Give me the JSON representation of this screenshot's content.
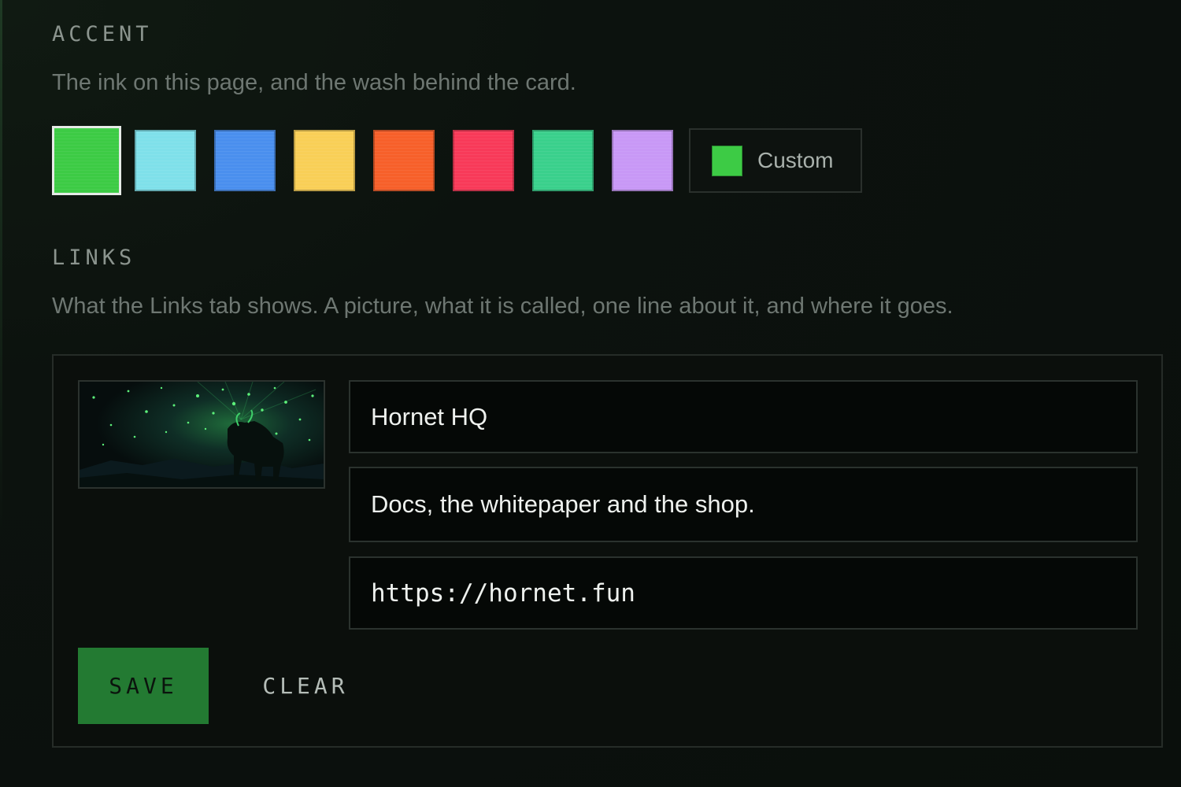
{
  "accent": {
    "label": "ACCENT",
    "description": "The ink on this page, and the wash behind the card.",
    "swatches": [
      {
        "name": "green",
        "color": "#3dcb45",
        "selected": true
      },
      {
        "name": "cyan",
        "color": "#7fe0ea",
        "selected": false
      },
      {
        "name": "blue",
        "color": "#4a8fee",
        "selected": false
      },
      {
        "name": "yellow",
        "color": "#f9cf57",
        "selected": false
      },
      {
        "name": "orange",
        "color": "#f7602a",
        "selected": false
      },
      {
        "name": "red",
        "color": "#f83a59",
        "selected": false
      },
      {
        "name": "teal",
        "color": "#3ad08c",
        "selected": false
      },
      {
        "name": "purple",
        "color": "#c898f6",
        "selected": false
      }
    ],
    "custom": {
      "label": "Custom",
      "color": "#3dcb45"
    }
  },
  "links": {
    "label": "LINKS",
    "description": "What the Links tab shows. A picture, what it is called, one line about it, and where it goes.",
    "item": {
      "image_icon": "bull-under-green-starfield-image",
      "title": "Hornet HQ",
      "description": "Docs, the whitepaper and the shop.",
      "url": "https://hornet.fun"
    },
    "save_label": "SAVE",
    "clear_label": "CLEAR"
  },
  "colors": {
    "background": "#0c120e",
    "save_button": "#237a32"
  }
}
